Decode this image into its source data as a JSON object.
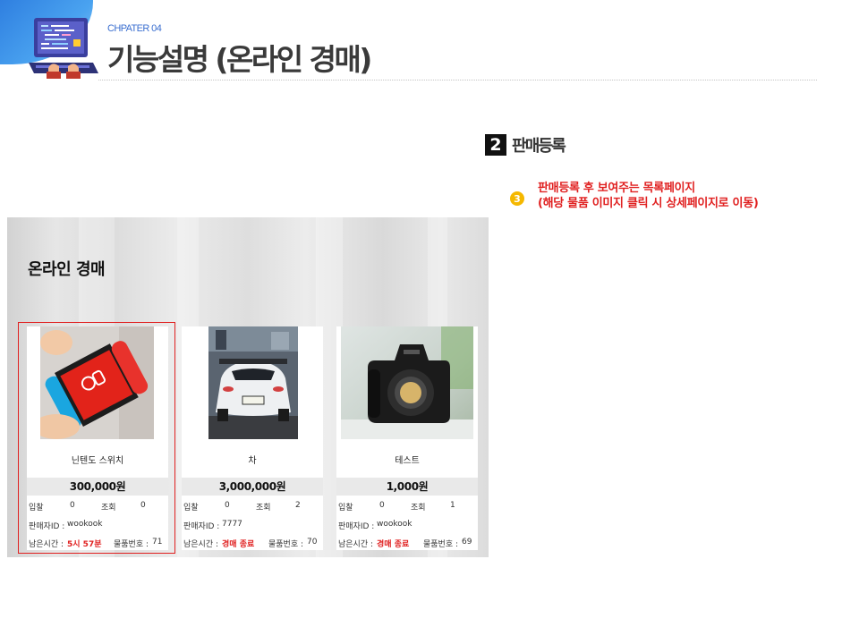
{
  "header": {
    "chapter": "CHPATER 04",
    "title": "기능설명 (온라인 경매)"
  },
  "section": {
    "number": "2",
    "label": "판매등록"
  },
  "note": {
    "badge": "3",
    "line1": "판매등록 후 보여주는 목록페이지",
    "line2": "(해당 물품 이미지 클릭 시 상세페이지로 이동)"
  },
  "auction": {
    "page_title": "온라인 경매",
    "labels": {
      "bid": "입찰",
      "views": "조회",
      "seller_prefix": "판매자ID : ",
      "remaining_prefix": "남은시간 : ",
      "item_no_prefix": "물품번호 : "
    },
    "items": [
      {
        "name": "닌텐도 스위치",
        "price": "300,000원",
        "bids": "0",
        "views": "0",
        "seller": "wookook",
        "remaining": "5시 57분",
        "item_no": "71",
        "image": "nintendo-switch-photo"
      },
      {
        "name": "차",
        "price": "3,000,000원",
        "bids": "0",
        "views": "2",
        "seller": "7777",
        "remaining": "경매 종료",
        "item_no": "70",
        "image": "white-sports-car-photo"
      },
      {
        "name": "테스트",
        "price": "1,000원",
        "bids": "0",
        "views": "1",
        "seller": "wookook",
        "remaining": "경매 종료",
        "item_no": "69",
        "image": "dslr-camera-photo"
      }
    ]
  },
  "colors": {
    "accent_blue": "#2f7fe0",
    "highlight_red": "#e02020",
    "badge_yellow": "#f5b800"
  }
}
